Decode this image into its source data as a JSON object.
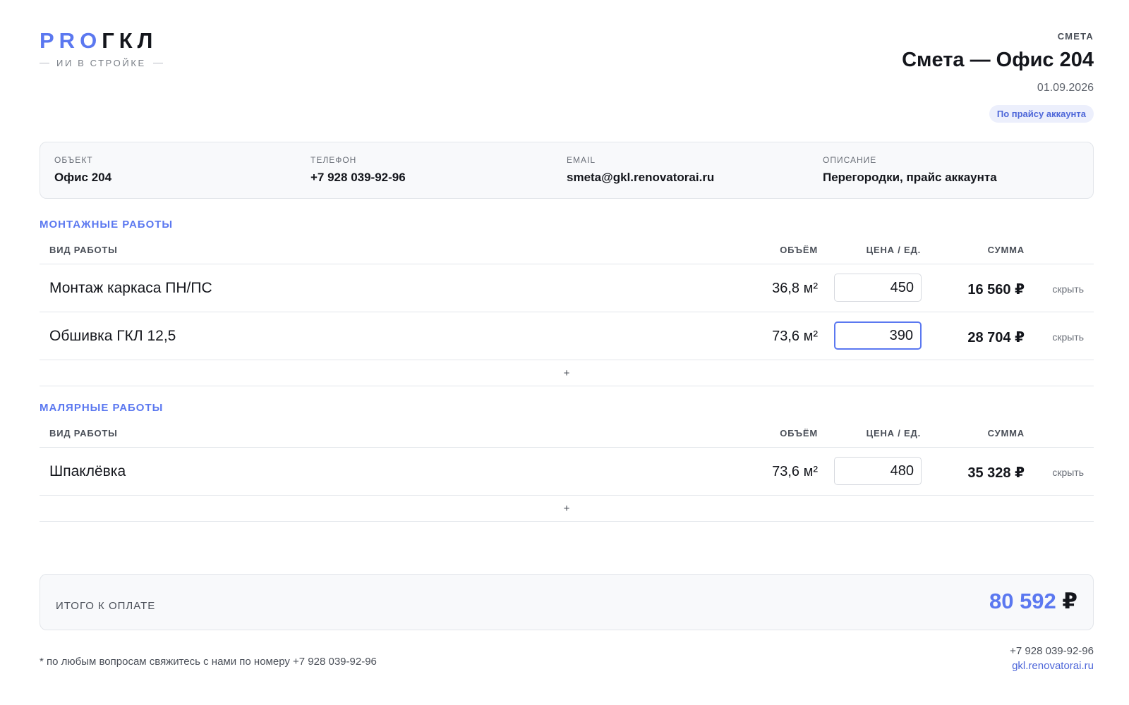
{
  "brand": {
    "pro": "PRO",
    "gkl": "ГКЛ",
    "tagline": "ИИ В СТРОЙКЕ"
  },
  "header": {
    "kind": "СМЕТА",
    "title": "Смета — Офис 204",
    "date": "01.09.2026",
    "badge": "По прайсу аккаунта"
  },
  "info": {
    "object_label": "ОБЪЕКТ",
    "object_value": "Офис 204",
    "phone_label": "ТЕЛЕФОН",
    "phone_value": "+7 928 039-92-96",
    "email_label": "EMAIL",
    "email_value": "smeta@gkl.renovatorai.ru",
    "desc_label": "ОПИСАНИЕ",
    "desc_value": "Перегородки, прайс аккаунта"
  },
  "columns": {
    "work": "ВИД РАБОТЫ",
    "volume": "ОБЪЁМ",
    "price": "ЦЕНА / ЕД.",
    "sum": "СУММА"
  },
  "sections": [
    {
      "title": "МОНТАЖНЫЕ РАБОТЫ",
      "rows": [
        {
          "name": "Монтаж каркаса ПН/ПС",
          "volume": "36,8 м²",
          "price": "450",
          "sum": "16 560 ₽",
          "hide": "скрыть"
        },
        {
          "name": "Обшивка ГКЛ 12,5",
          "volume": "73,6 м²",
          "price": "390",
          "sum": "28 704 ₽",
          "hide": "скрыть"
        }
      ],
      "add": "+"
    },
    {
      "title": "МАЛЯРНЫЕ РАБОТЫ",
      "rows": [
        {
          "name": "Шпаклёвка",
          "volume": "73,6 м²",
          "price": "480",
          "sum": "35 328 ₽",
          "hide": "скрыть"
        }
      ],
      "add": "+"
    }
  ],
  "total": {
    "label": "ИТОГО К ОПЛАТЕ",
    "amount": "80 592",
    "currency": "₽"
  },
  "footer": {
    "note": "* по любым вопросам свяжитесь с нами по номеру +7 928 039-92-96",
    "phone": "+7 928 039-92-96",
    "site": "gkl.renovatorai.ru"
  },
  "colors": {
    "accent": "#5b78f0",
    "text": "#14161c",
    "muted": "#4a4f58",
    "border": "#e2e5ea"
  }
}
